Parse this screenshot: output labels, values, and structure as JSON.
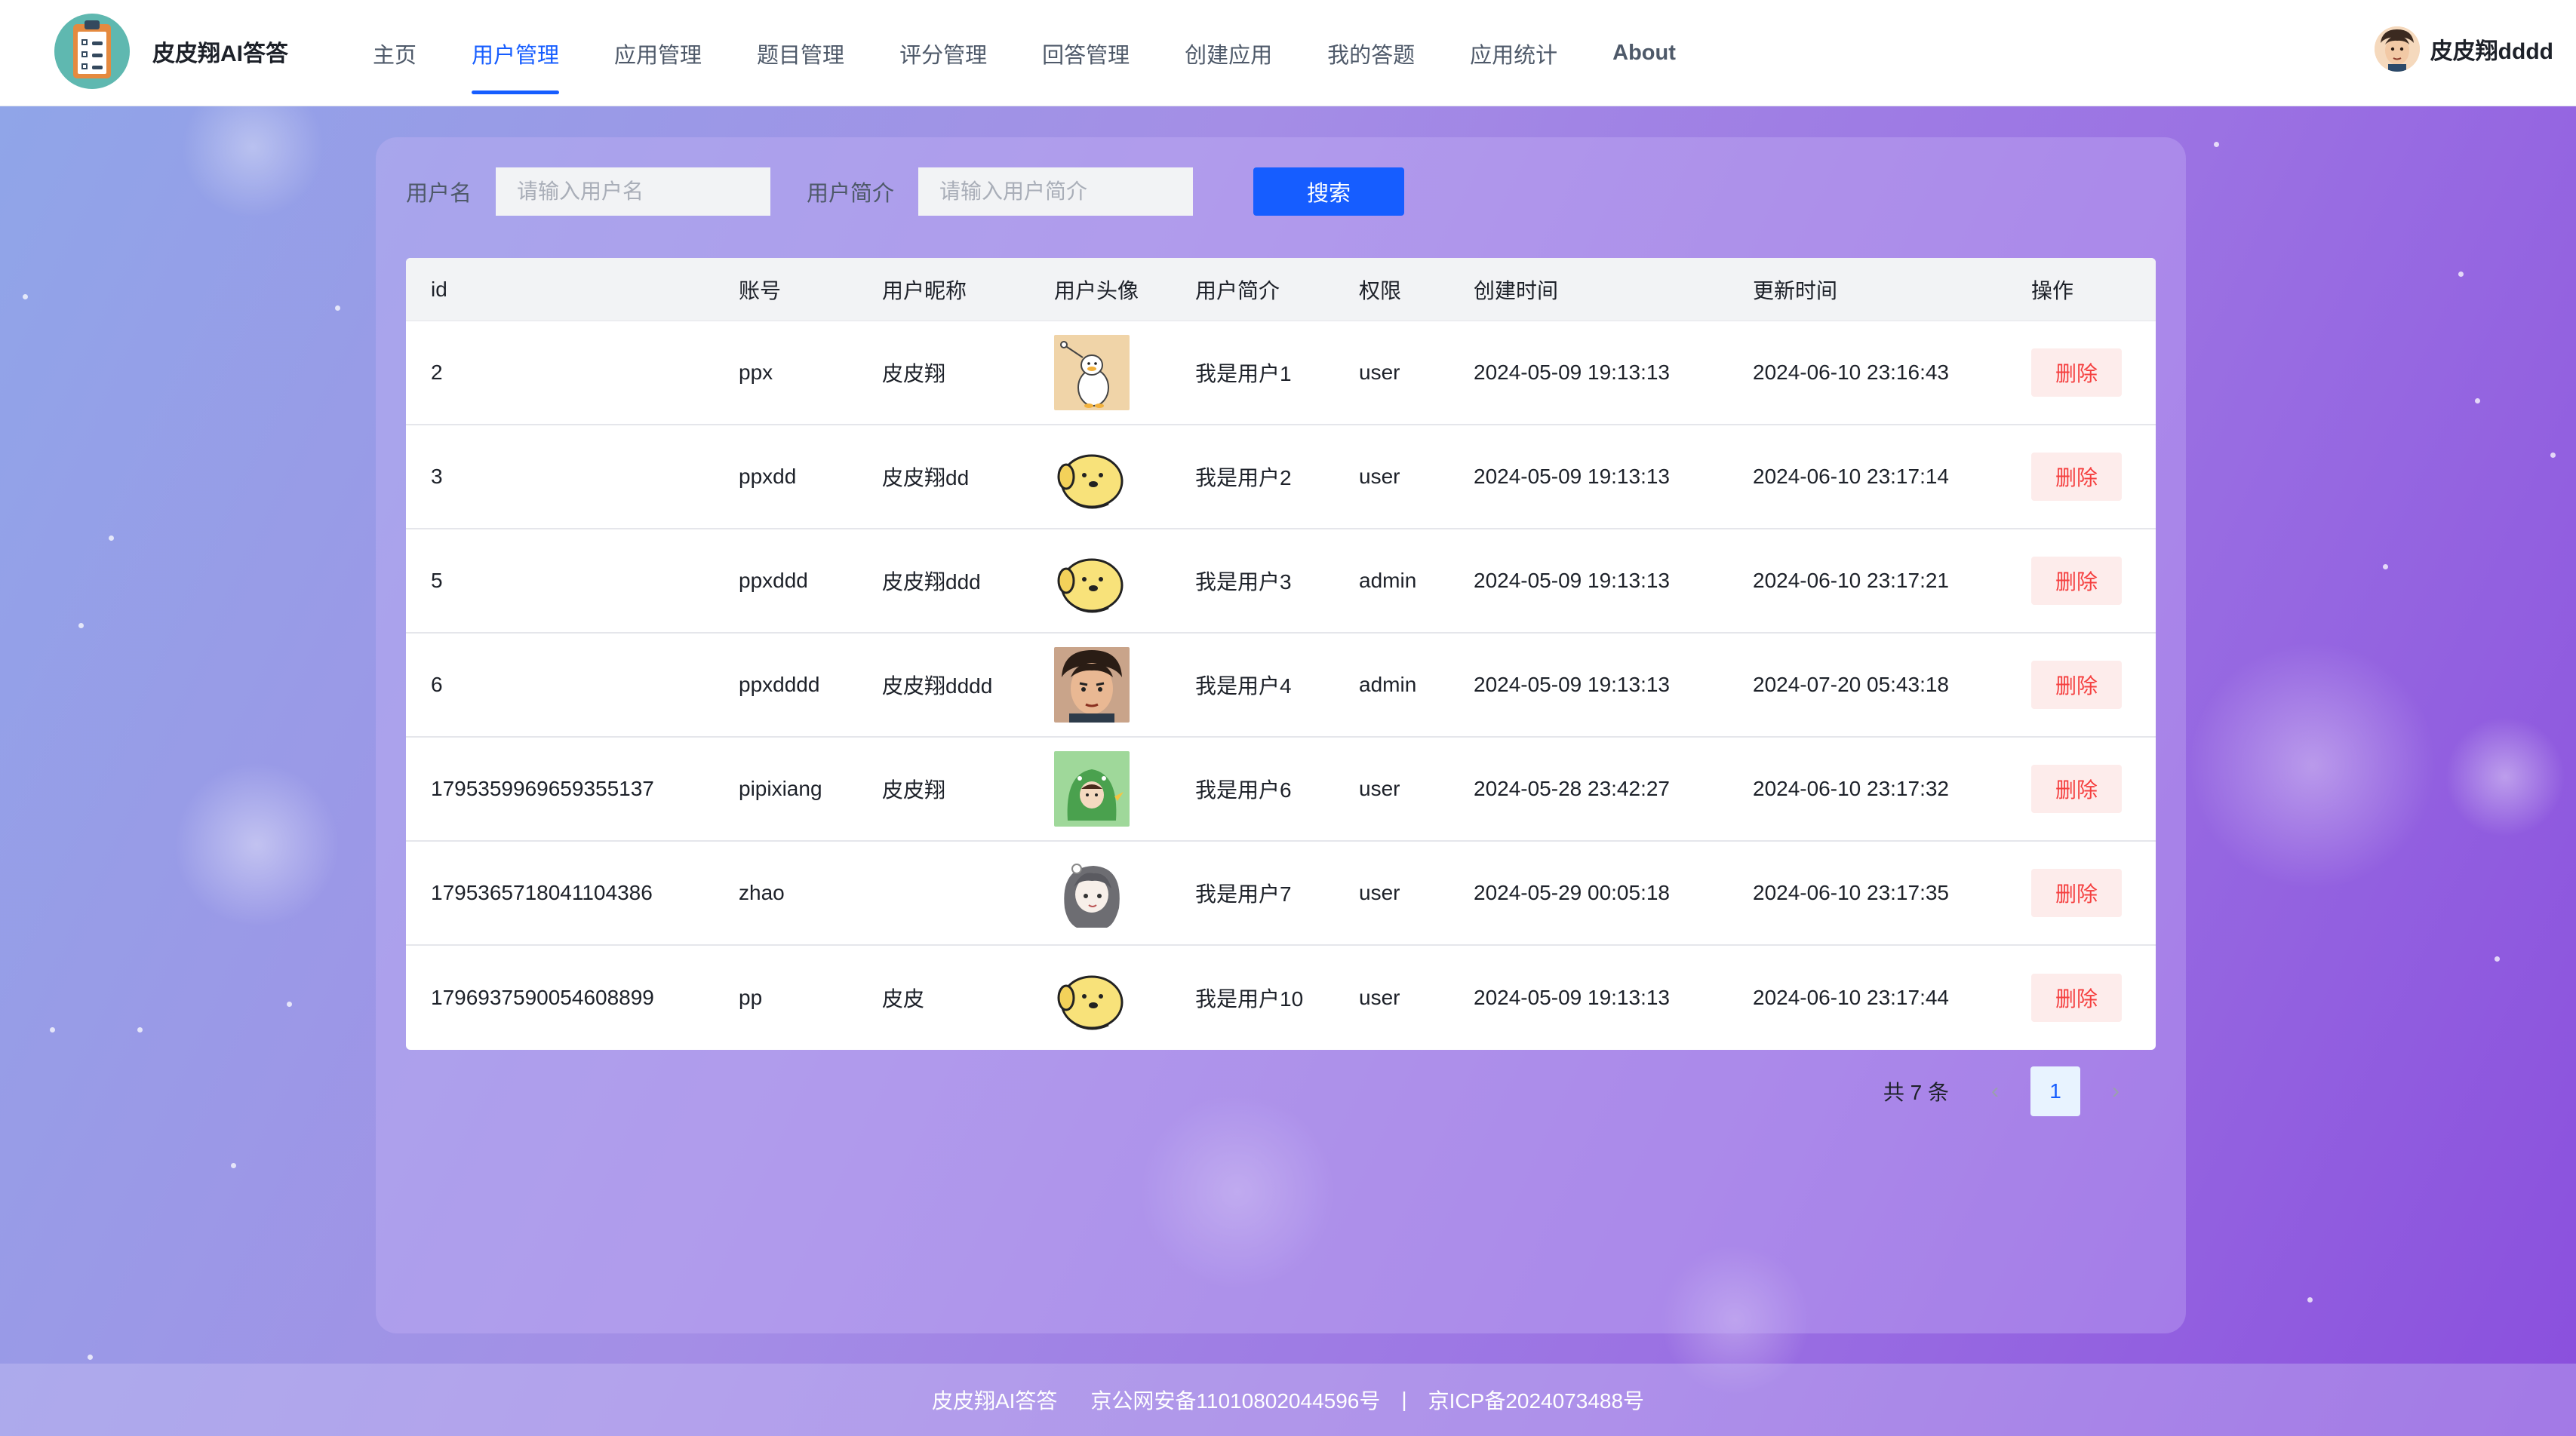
{
  "header": {
    "brand": "皮皮翔AI答答",
    "nav": [
      "主页",
      "用户管理",
      "应用管理",
      "题目管理",
      "评分管理",
      "回答管理",
      "创建应用",
      "我的答题",
      "应用统计",
      "About"
    ],
    "active_index": 1,
    "user_name": "皮皮翔dddd"
  },
  "search": {
    "username_label": "用户名",
    "username_placeholder": "请输入用户名",
    "profile_label": "用户简介",
    "profile_placeholder": "请输入用户简介",
    "button_label": "搜索"
  },
  "table": {
    "columns": [
      "id",
      "账号",
      "用户昵称",
      "用户头像",
      "用户简介",
      "权限",
      "创建时间",
      "更新时间",
      "操作"
    ],
    "rows": [
      {
        "id": "2",
        "account": "ppx",
        "nickname": "皮皮翔",
        "avatar": "duck-avatar",
        "profile": "我是用户1",
        "role": "user",
        "created": "2024-05-09 19:13:13",
        "updated": "2024-06-10 23:16:43",
        "action": "删除"
      },
      {
        "id": "3",
        "account": "ppxdd",
        "nickname": "皮皮翔dd",
        "avatar": "dog-avatar",
        "profile": "我是用户2",
        "role": "user",
        "created": "2024-05-09 19:13:13",
        "updated": "2024-06-10 23:17:14",
        "action": "删除"
      },
      {
        "id": "5",
        "account": "ppxddd",
        "nickname": "皮皮翔ddd",
        "avatar": "dog-avatar",
        "profile": "我是用户3",
        "role": "admin",
        "created": "2024-05-09 19:13:13",
        "updated": "2024-06-10 23:17:21",
        "action": "删除"
      },
      {
        "id": "6",
        "account": "ppxdddd",
        "nickname": "皮皮翔dddd",
        "avatar": "man-avatar",
        "profile": "我是用户4",
        "role": "admin",
        "created": "2024-05-09 19:13:13",
        "updated": "2024-07-20 05:43:18",
        "action": "删除"
      },
      {
        "id": "1795359969659355137",
        "account": "pipixiang",
        "nickname": "皮皮翔",
        "avatar": "dino-avatar",
        "profile": "我是用户6",
        "role": "user",
        "created": "2024-05-28 23:42:27",
        "updated": "2024-06-10 23:17:32",
        "action": "删除"
      },
      {
        "id": "1795365718041104386",
        "account": "zhao",
        "nickname": "",
        "avatar": "girl-avatar",
        "profile": "我是用户7",
        "role": "user",
        "created": "2024-05-29 00:05:18",
        "updated": "2024-06-10 23:17:35",
        "action": "删除"
      },
      {
        "id": "1796937590054608899",
        "account": "pp",
        "nickname": "皮皮",
        "avatar": "dog-avatar",
        "profile": "我是用户10",
        "role": "user",
        "created": "2024-05-09 19:13:13",
        "updated": "2024-06-10 23:17:44",
        "action": "删除"
      }
    ]
  },
  "pagination": {
    "total_text": "共 7 条",
    "current_page": "1",
    "prev_icon": "chevron-left-icon",
    "next_icon": "chevron-right-icon"
  },
  "footer": {
    "items": [
      "皮皮翔AI答答",
      "京公网安备11010802044596号",
      "|",
      "京ICP备2024073488号"
    ]
  },
  "colors": {
    "primary": "#165dff",
    "danger": "#f53f3f",
    "danger_bg": "#fdeceb"
  }
}
